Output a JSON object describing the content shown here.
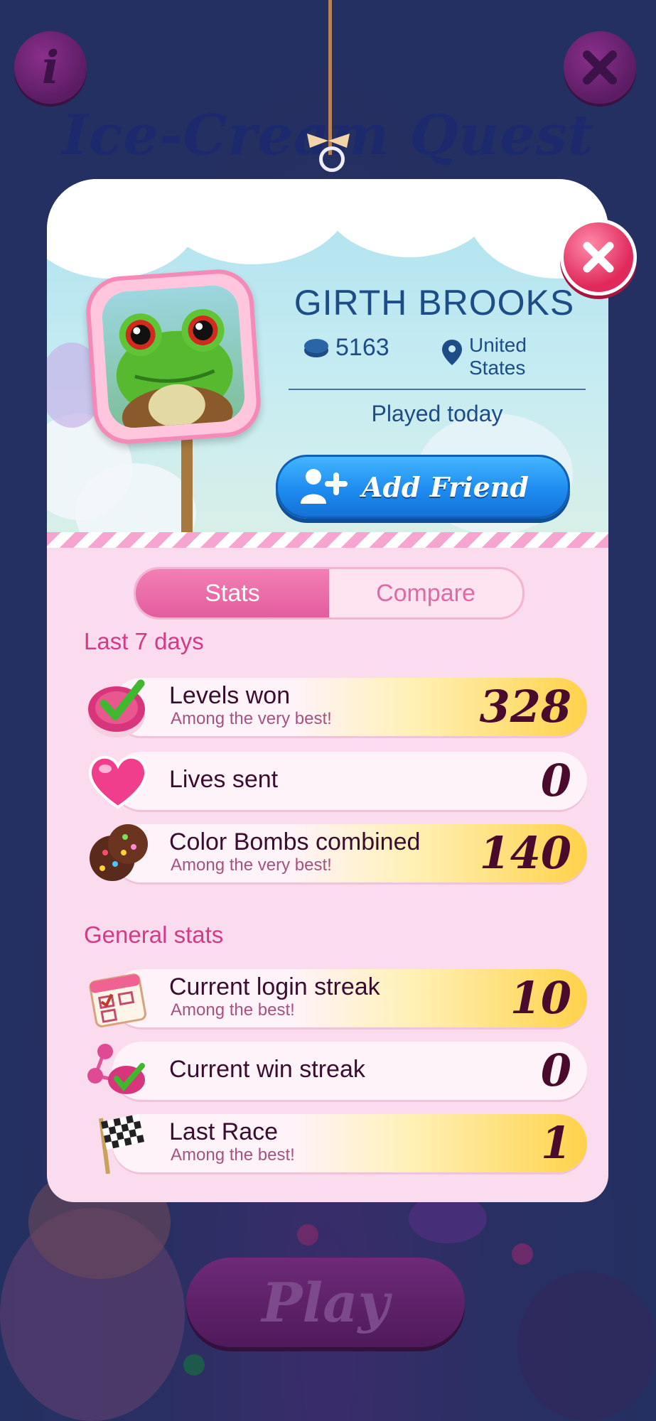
{
  "background": {
    "game_title": "Ice-Cream Quest",
    "play_label": "Play",
    "info_label": "i"
  },
  "profile": {
    "name": "GIRTH BROOKS",
    "points": "5163",
    "location_line1": "United",
    "location_line2": "States",
    "last_played": "Played today",
    "add_friend_label": "Add Friend"
  },
  "tabs": [
    {
      "label": "Stats",
      "active": true
    },
    {
      "label": "Compare",
      "active": false
    }
  ],
  "sections": {
    "last_7_days": {
      "heading": "Last 7 days",
      "rows": [
        {
          "title": "Levels won",
          "subtitle": "Among the very best!",
          "value": "328",
          "icon": "checkmark-icon"
        },
        {
          "title": "Lives sent",
          "subtitle": "",
          "value": "0",
          "icon": "heart-icon"
        },
        {
          "title": "Color Bombs combined",
          "subtitle": "Among the very best!",
          "value": "140",
          "icon": "color-bomb-icon"
        }
      ]
    },
    "general": {
      "heading": "General stats",
      "rows": [
        {
          "title": "Current login streak",
          "subtitle": "Among the best!",
          "value": "10",
          "icon": "calendar-icon"
        },
        {
          "title": "Current win streak",
          "subtitle": "",
          "value": "0",
          "icon": "win-streak-icon"
        },
        {
          "title": "Last Race",
          "subtitle": "Among the best!",
          "value": "1",
          "icon": "checkered-flag-icon"
        }
      ]
    }
  },
  "colors": {
    "accent_pink": "#e25d9e",
    "gold": "#ffd24a",
    "friend_blue": "#1e8cf0",
    "close_red": "#e02a5c"
  }
}
